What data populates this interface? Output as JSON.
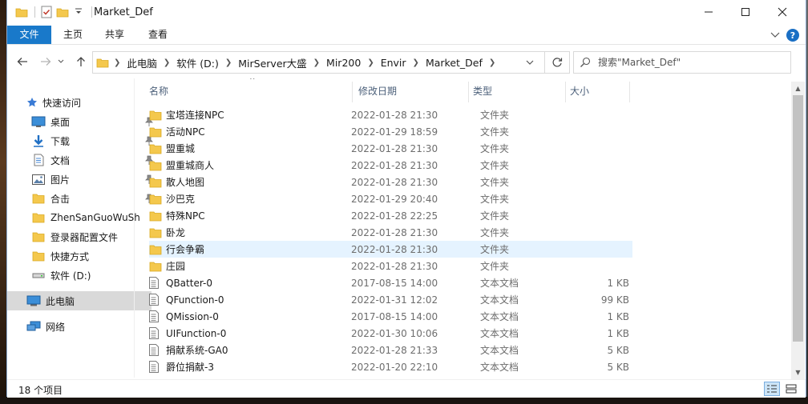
{
  "window": {
    "title": "Market_Def"
  },
  "ribbon": {
    "tabs": [
      "文件",
      "主页",
      "共享",
      "查看"
    ],
    "help_label": "?"
  },
  "address": {
    "crumbs": [
      "此电脑",
      "软件 (D:)",
      "MirServer大盛",
      "Mir200",
      "Envir",
      "Market_Def"
    ]
  },
  "search": {
    "placeholder": "搜索\"Market_Def\""
  },
  "sidebar": {
    "items": [
      {
        "label": "快速访问",
        "icon": "star-icon"
      },
      {
        "label": "桌面",
        "icon": "desktop-icon",
        "pinned": true
      },
      {
        "label": "下载",
        "icon": "download-icon",
        "pinned": true
      },
      {
        "label": "文档",
        "icon": "document-icon",
        "pinned": true
      },
      {
        "label": "图片",
        "icon": "picture-icon",
        "pinned": true
      },
      {
        "label": "合击",
        "icon": "folder-icon",
        "pinned": true
      },
      {
        "label": "ZhenSanGuoWuSh",
        "icon": "folder-icon"
      },
      {
        "label": "登录器配置文件",
        "icon": "folder-icon"
      },
      {
        "label": "快捷方式",
        "icon": "folder-icon"
      },
      {
        "label": "软件 (D:)",
        "icon": "drive-icon"
      },
      {
        "label": "此电脑",
        "icon": "computer-icon",
        "selected": true
      },
      {
        "label": "网络",
        "icon": "network-icon"
      }
    ]
  },
  "columns": {
    "name": "名称",
    "date": "修改日期",
    "type": "类型",
    "size": "大小"
  },
  "files": [
    {
      "name": "宝塔连接NPC",
      "date": "2022-01-28 21:30",
      "type": "文件夹",
      "size": "",
      "kind": "folder"
    },
    {
      "name": "活动NPC",
      "date": "2022-01-29 18:59",
      "type": "文件夹",
      "size": "",
      "kind": "folder"
    },
    {
      "name": "盟重城",
      "date": "2022-01-28 21:30",
      "type": "文件夹",
      "size": "",
      "kind": "folder"
    },
    {
      "name": "盟重城商人",
      "date": "2022-01-28 21:30",
      "type": "文件夹",
      "size": "",
      "kind": "folder"
    },
    {
      "name": "散人地图",
      "date": "2022-01-28 21:30",
      "type": "文件夹",
      "size": "",
      "kind": "folder"
    },
    {
      "name": "沙巴克",
      "date": "2022-01-29 20:40",
      "type": "文件夹",
      "size": "",
      "kind": "folder"
    },
    {
      "name": "特殊NPC",
      "date": "2022-01-28 22:25",
      "type": "文件夹",
      "size": "",
      "kind": "folder"
    },
    {
      "name": "卧龙",
      "date": "2022-01-28 21:30",
      "type": "文件夹",
      "size": "",
      "kind": "folder"
    },
    {
      "name": "行会争霸",
      "date": "2022-01-28 21:30",
      "type": "文件夹",
      "size": "",
      "kind": "folder",
      "hovered": true
    },
    {
      "name": "庄园",
      "date": "2022-01-28 21:30",
      "type": "文件夹",
      "size": "",
      "kind": "folder"
    },
    {
      "name": "QBatter-0",
      "date": "2017-08-15 14:00",
      "type": "文本文档",
      "size": "1 KB",
      "kind": "text"
    },
    {
      "name": "QFunction-0",
      "date": "2022-01-31 12:02",
      "type": "文本文档",
      "size": "99 KB",
      "kind": "text"
    },
    {
      "name": "QMission-0",
      "date": "2017-08-15 14:00",
      "type": "文本文档",
      "size": "1 KB",
      "kind": "text"
    },
    {
      "name": "UIFunction-0",
      "date": "2022-01-30 10:06",
      "type": "文本文档",
      "size": "1 KB",
      "kind": "text"
    },
    {
      "name": "捐献系统-GA0",
      "date": "2022-01-28 21:33",
      "type": "文本文档",
      "size": "5 KB",
      "kind": "text"
    },
    {
      "name": "爵位捐献-3",
      "date": "2022-01-20 22:10",
      "type": "文本文档",
      "size": "5 KB",
      "kind": "text"
    }
  ],
  "status": {
    "item_count": "18 个项目"
  },
  "colors": {
    "accent": "#1979ca",
    "folder": "#f4c84d",
    "hover": "#e5f3ff",
    "selected_nav": "#d9d9d9"
  }
}
